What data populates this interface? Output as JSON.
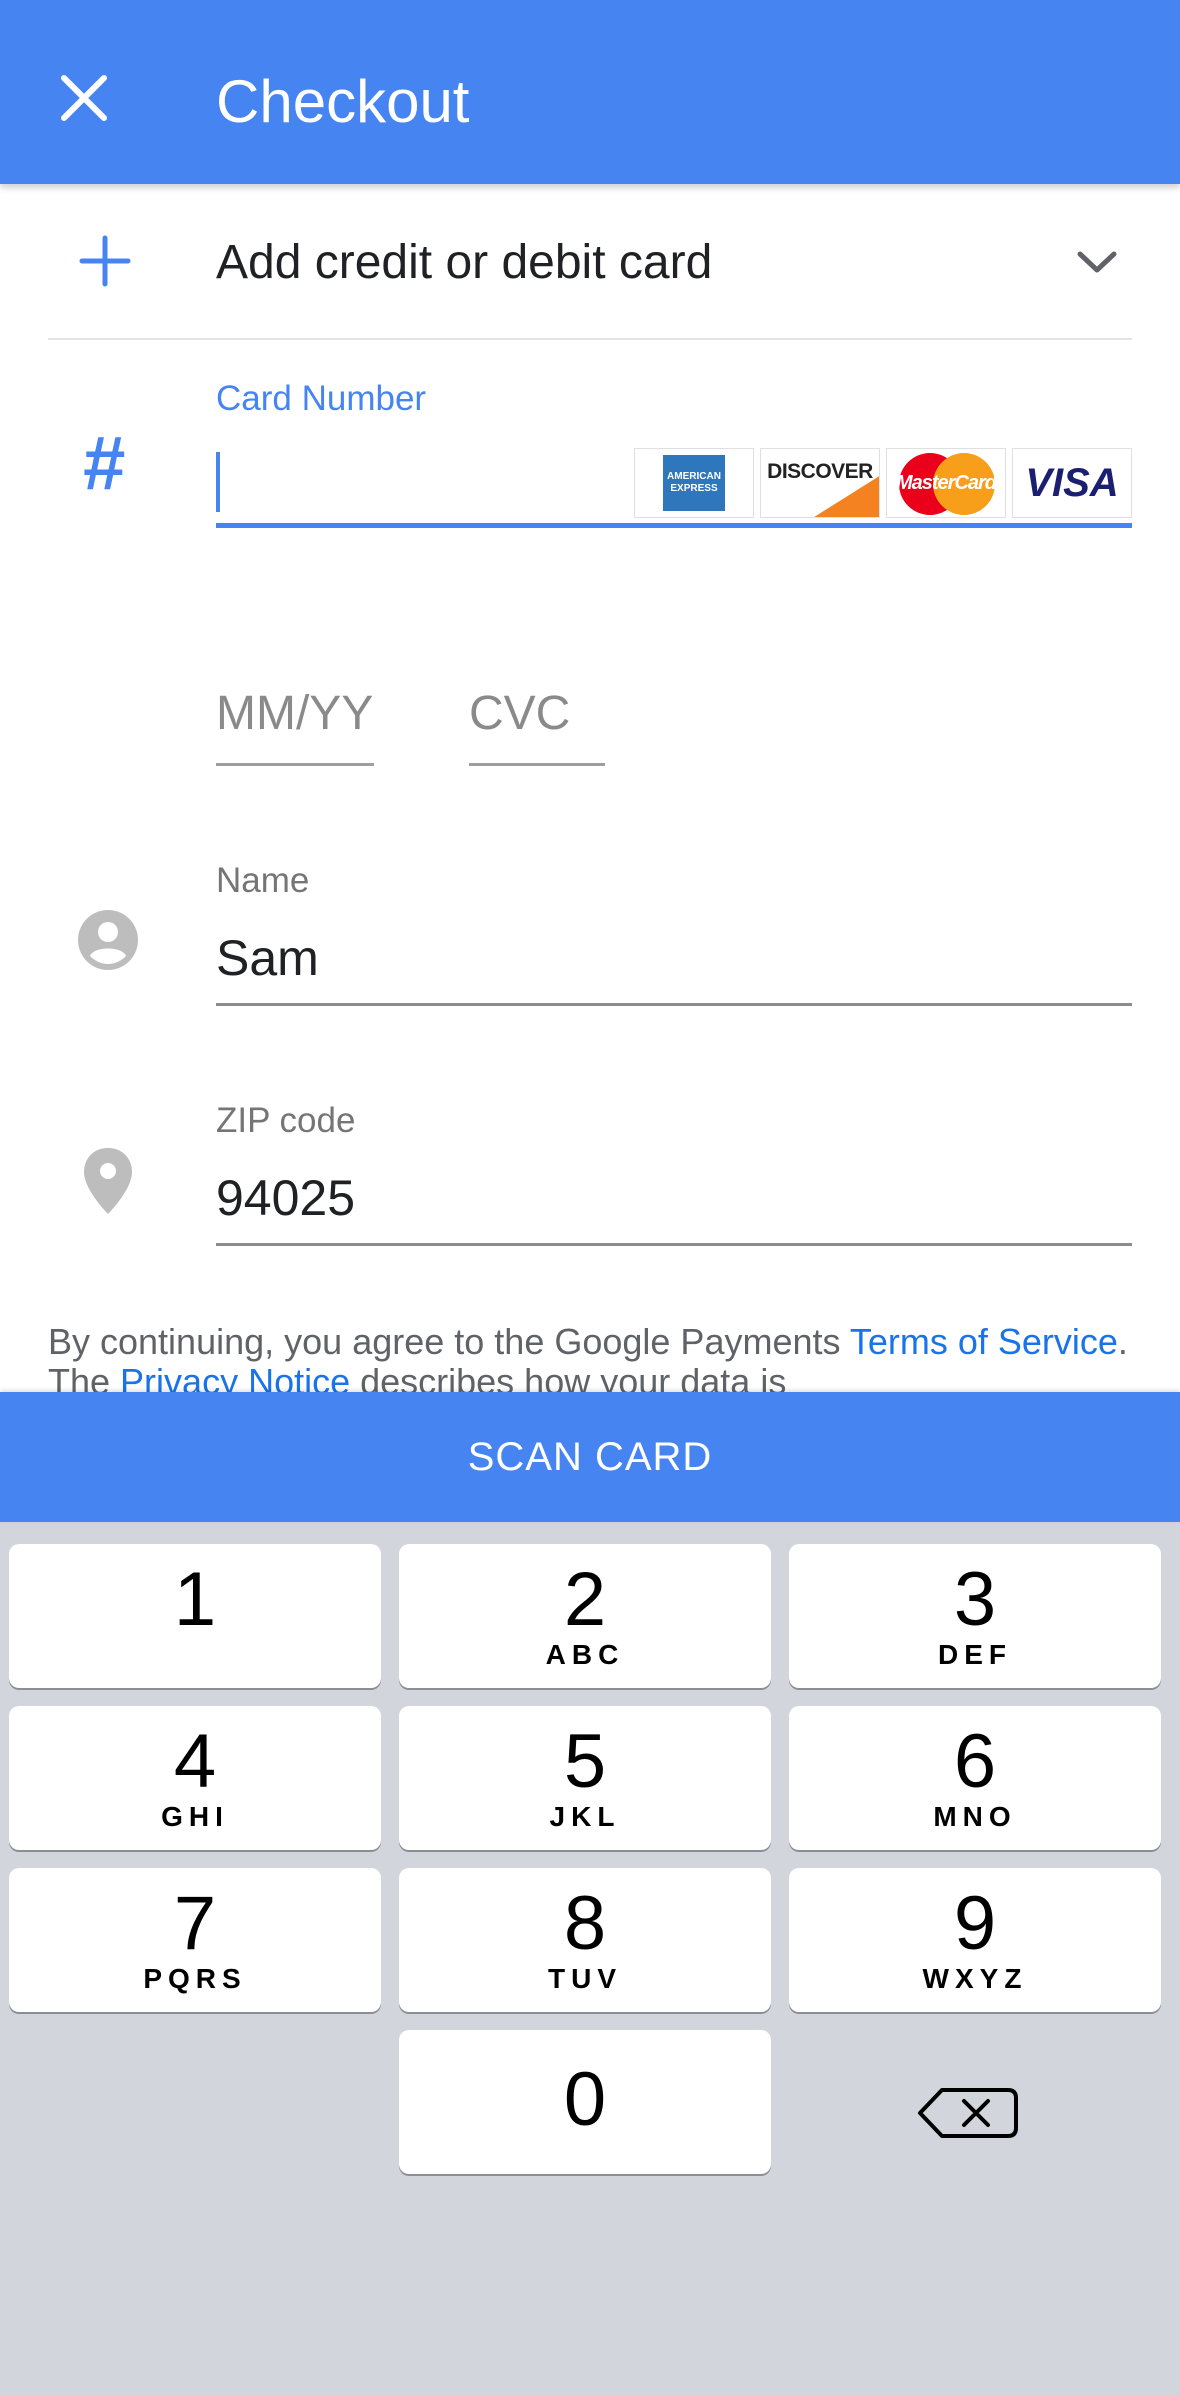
{
  "header": {
    "title": "Checkout"
  },
  "add_card": {
    "label": "Add credit or debit card"
  },
  "card_number": {
    "label": "Card Number",
    "value": "",
    "card_logos": [
      {
        "name": "amex",
        "text_top": "AMERICAN",
        "text_bottom": "EXPRESS",
        "color": "#2e77bc"
      },
      {
        "name": "discover",
        "text": "DISCOVER",
        "color": "#f58220"
      },
      {
        "name": "mastercard",
        "text": "MasterCard",
        "color": "#eb001b"
      },
      {
        "name": "visa",
        "text": "VISA",
        "color": "#1a1f71"
      }
    ]
  },
  "expiry": {
    "placeholder": "MM/YY"
  },
  "cvc": {
    "placeholder": "CVC"
  },
  "name": {
    "label": "Name",
    "value": "Sam"
  },
  "zip": {
    "label": "ZIP code",
    "value": "94025"
  },
  "legal": {
    "text_before": "By continuing, you agree to the Google Payments ",
    "terms_link": "Terms of Service",
    "text_middle": ". The ",
    "privacy_link": "Privacy Notice",
    "text_after": " describes how your data is"
  },
  "scan_button": {
    "label": "SCAN CARD"
  },
  "keypad": {
    "keys": [
      {
        "digit": "1",
        "letters": ""
      },
      {
        "digit": "2",
        "letters": "ABC"
      },
      {
        "digit": "3",
        "letters": "DEF"
      },
      {
        "digit": "4",
        "letters": "GHI"
      },
      {
        "digit": "5",
        "letters": "JKL"
      },
      {
        "digit": "6",
        "letters": "MNO"
      },
      {
        "digit": "7",
        "letters": "PQRS"
      },
      {
        "digit": "8",
        "letters": "TUV"
      },
      {
        "digit": "9",
        "letters": "WXYZ"
      },
      {
        "digit": "0",
        "letters": ""
      }
    ],
    "delete_icon": "backspace-icon"
  },
  "colors": {
    "accent": "#4685f1",
    "keypad_bg": "#d2d5db",
    "link": "#1a73e8"
  }
}
